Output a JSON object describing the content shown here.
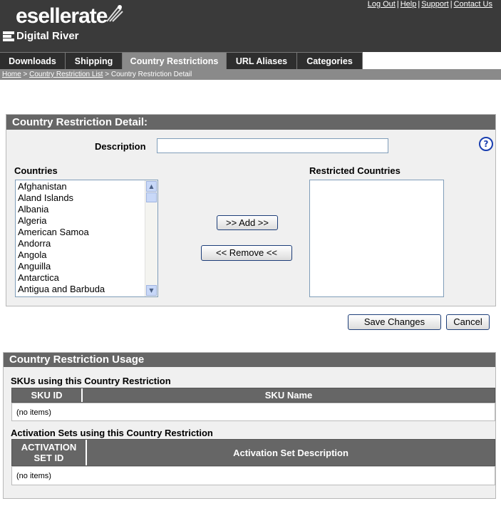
{
  "brand": {
    "logo_text": "esellerate",
    "company_text": "Digital River"
  },
  "top_links": [
    "Log Out",
    "Help",
    "Support",
    "Contact Us"
  ],
  "tabs": [
    {
      "label": "Downloads",
      "active": false
    },
    {
      "label": "Shipping",
      "active": false
    },
    {
      "label": "Country Restrictions",
      "active": true
    },
    {
      "label": "URL Aliases",
      "active": false
    },
    {
      "label": "Categories",
      "active": false
    }
  ],
  "breadcrumb": {
    "home": "Home",
    "list": "Country Restriction List",
    "current": "Country Restriction Detail",
    "separator": " > "
  },
  "detail": {
    "title": "Country Restriction Detail:",
    "description_label": "Description",
    "description_value": "",
    "help_icon": "?",
    "countries_label": "Countries",
    "restricted_label": "Restricted Countries",
    "countries": [
      "Afghanistan",
      "Aland Islands",
      "Albania",
      "Algeria",
      "American Samoa",
      "Andorra",
      "Angola",
      "Anguilla",
      "Antarctica",
      "Antigua and Barbuda"
    ],
    "restricted_countries": [],
    "add_label": ">> Add >>",
    "remove_label": "<< Remove <<"
  },
  "actions": {
    "save_label": "Save Changes",
    "cancel_label": "Cancel"
  },
  "usage": {
    "title": "Country Restriction Usage",
    "skus_heading": "SKUs using this Country Restriction",
    "sku_columns": [
      "SKU ID",
      "SKU Name"
    ],
    "sku_empty": "(no items)",
    "activation_heading": "Activation Sets using this Country Restriction",
    "activation_columns": [
      "ACTIVATION SET ID",
      "Activation Set Description"
    ],
    "activation_empty": "(no items)"
  },
  "colors": {
    "header_bg": "#3a3a3a",
    "tab_bg": "#2e2e2e",
    "tab_active": "#8a8a8a",
    "panel_title": "#666666",
    "help_blue": "#1a3fb0"
  },
  "icons": {
    "help": "help-icon",
    "scroll_up": "scroll-up-icon",
    "scroll_down": "scroll-down-icon",
    "rocket": "rocket-logo-icon",
    "dr": "digital-river-mark-icon"
  }
}
